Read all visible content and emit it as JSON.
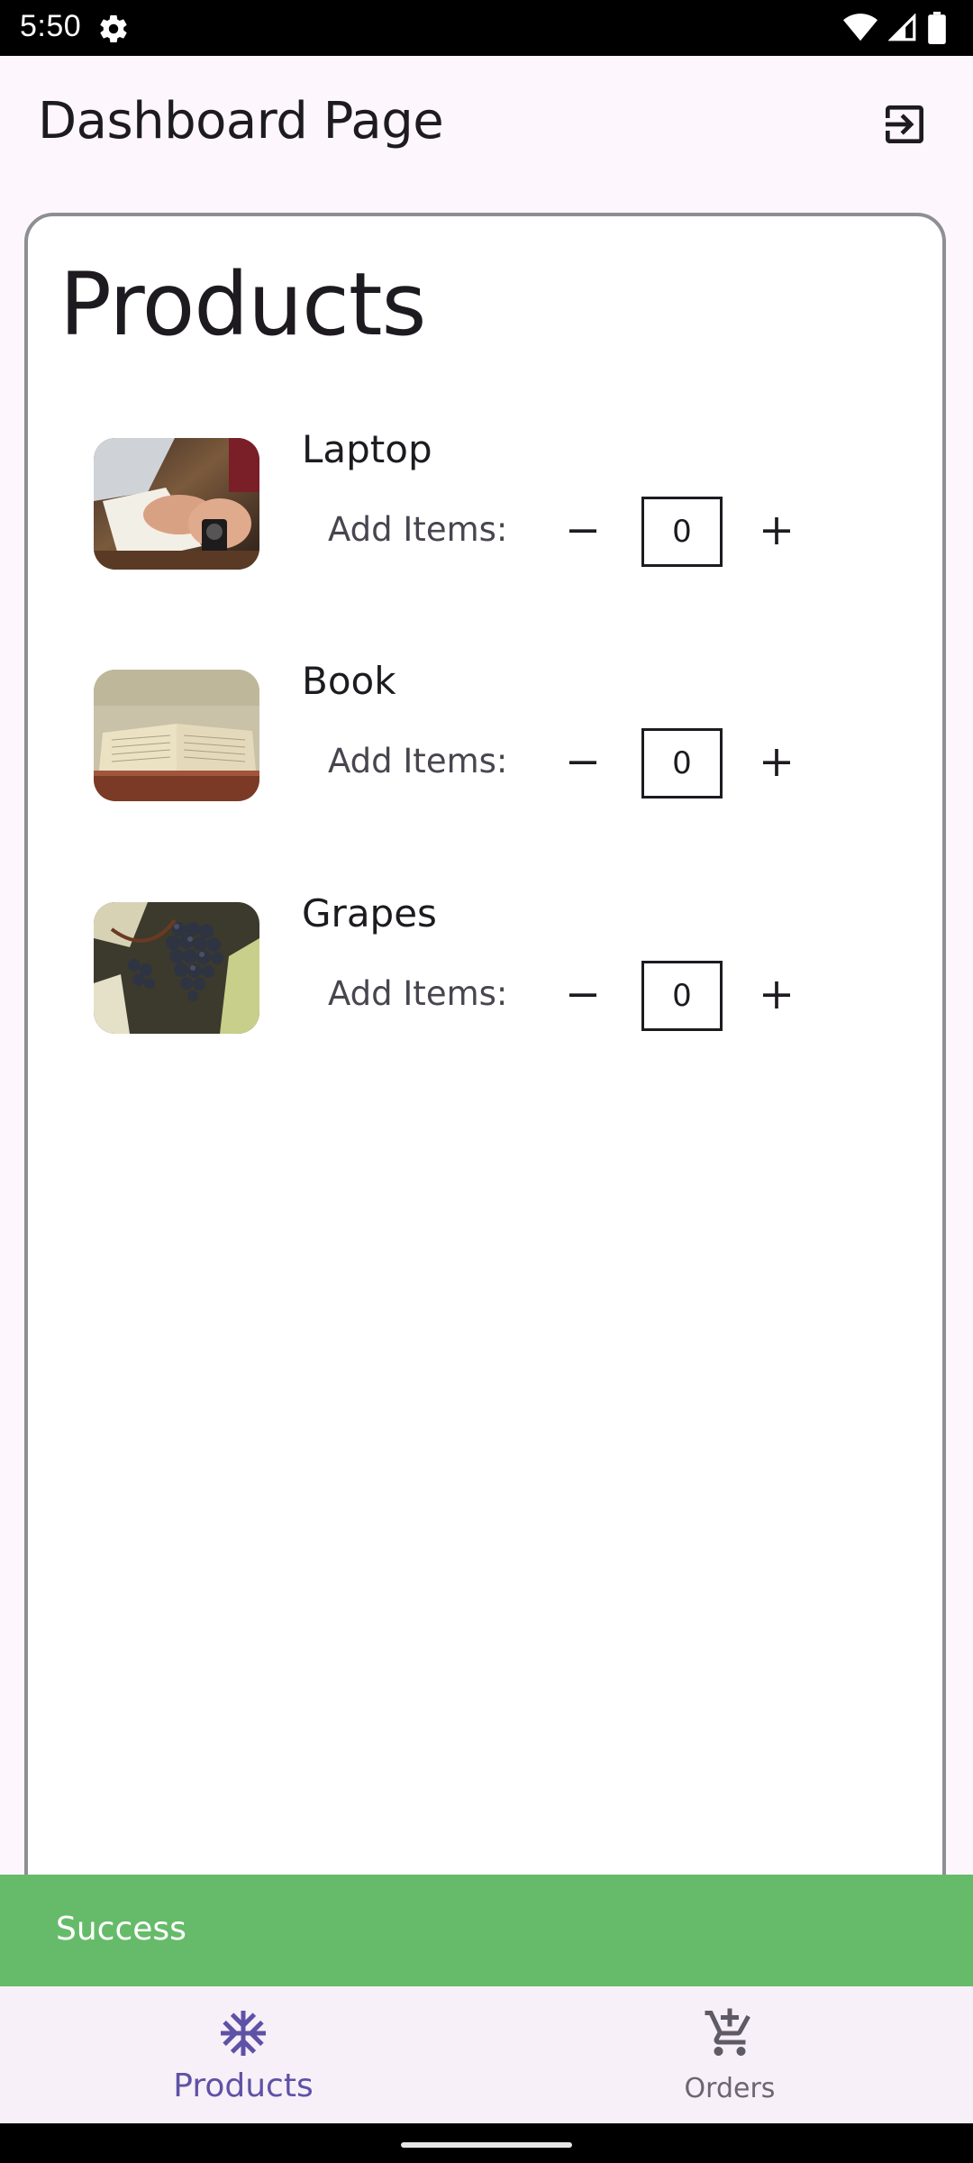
{
  "status_bar": {
    "time": "5:50"
  },
  "app_bar": {
    "title": "Dashboard Page",
    "action_icon": "logout-icon"
  },
  "card": {
    "heading": "Products"
  },
  "products": [
    {
      "name": "Laptop",
      "add_label": "Add Items:",
      "quantity": "0",
      "image": "laptop-photo"
    },
    {
      "name": "Book",
      "add_label": "Add Items:",
      "quantity": "0",
      "image": "book-photo"
    },
    {
      "name": "Grapes",
      "add_label": "Add Items:",
      "quantity": "0",
      "image": "grapes-photo"
    }
  ],
  "snackbar": {
    "message": "Success",
    "color": "#66bb6a"
  },
  "bottom_nav": {
    "items": [
      {
        "label": "Products",
        "icon": "snowflake-icon",
        "active": true
      },
      {
        "label": "Orders",
        "icon": "add-shopping-cart-icon",
        "active": false
      }
    ],
    "accent": "#5e52a6"
  }
}
